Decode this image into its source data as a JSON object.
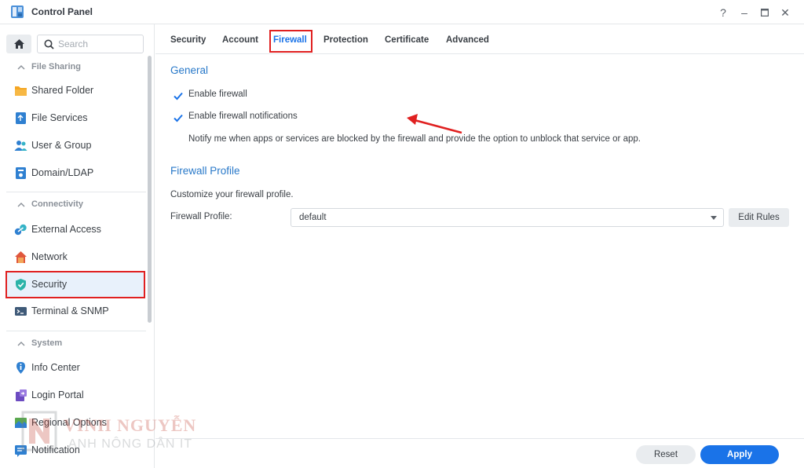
{
  "window": {
    "title": "Control Panel",
    "controls": {
      "help": "?",
      "minimize": "–",
      "maximize": "□",
      "close": "✕"
    }
  },
  "sidebar": {
    "search_placeholder": "Search",
    "groups": [
      {
        "label": "File Sharing",
        "items": [
          "Shared Folder",
          "File Services",
          "User & Group",
          "Domain/LDAP"
        ]
      },
      {
        "label": "Connectivity",
        "items": [
          "External Access",
          "Network",
          "Security",
          "Terminal & SNMP"
        ]
      },
      {
        "label": "System",
        "items": [
          "Info Center",
          "Login Portal",
          "Regional Options",
          "Notification"
        ]
      }
    ],
    "active_item": "Security"
  },
  "tabs": [
    "Security",
    "Account",
    "Firewall",
    "Protection",
    "Certificate",
    "Advanced"
  ],
  "active_tab": "Firewall",
  "general": {
    "title": "General",
    "enable_firewall": {
      "label": "Enable firewall",
      "checked": true
    },
    "enable_notifications": {
      "label": "Enable firewall notifications",
      "checked": true
    },
    "notify_hint": "Notify me when apps or services are blocked by the firewall and provide the option to unblock that service or app."
  },
  "profile": {
    "title": "Firewall Profile",
    "description": "Customize your firewall profile.",
    "field_label": "Firewall Profile:",
    "selected": "default",
    "edit_button": "Edit Rules"
  },
  "footer": {
    "reset": "Reset",
    "apply": "Apply"
  },
  "watermark": {
    "line1": "VINH NGUYỄN",
    "line2": "ANH NÔNG DÂN IT"
  },
  "colors": {
    "accent": "#1a73e8",
    "section_title": "#2979c9",
    "highlight": "#e02020"
  }
}
